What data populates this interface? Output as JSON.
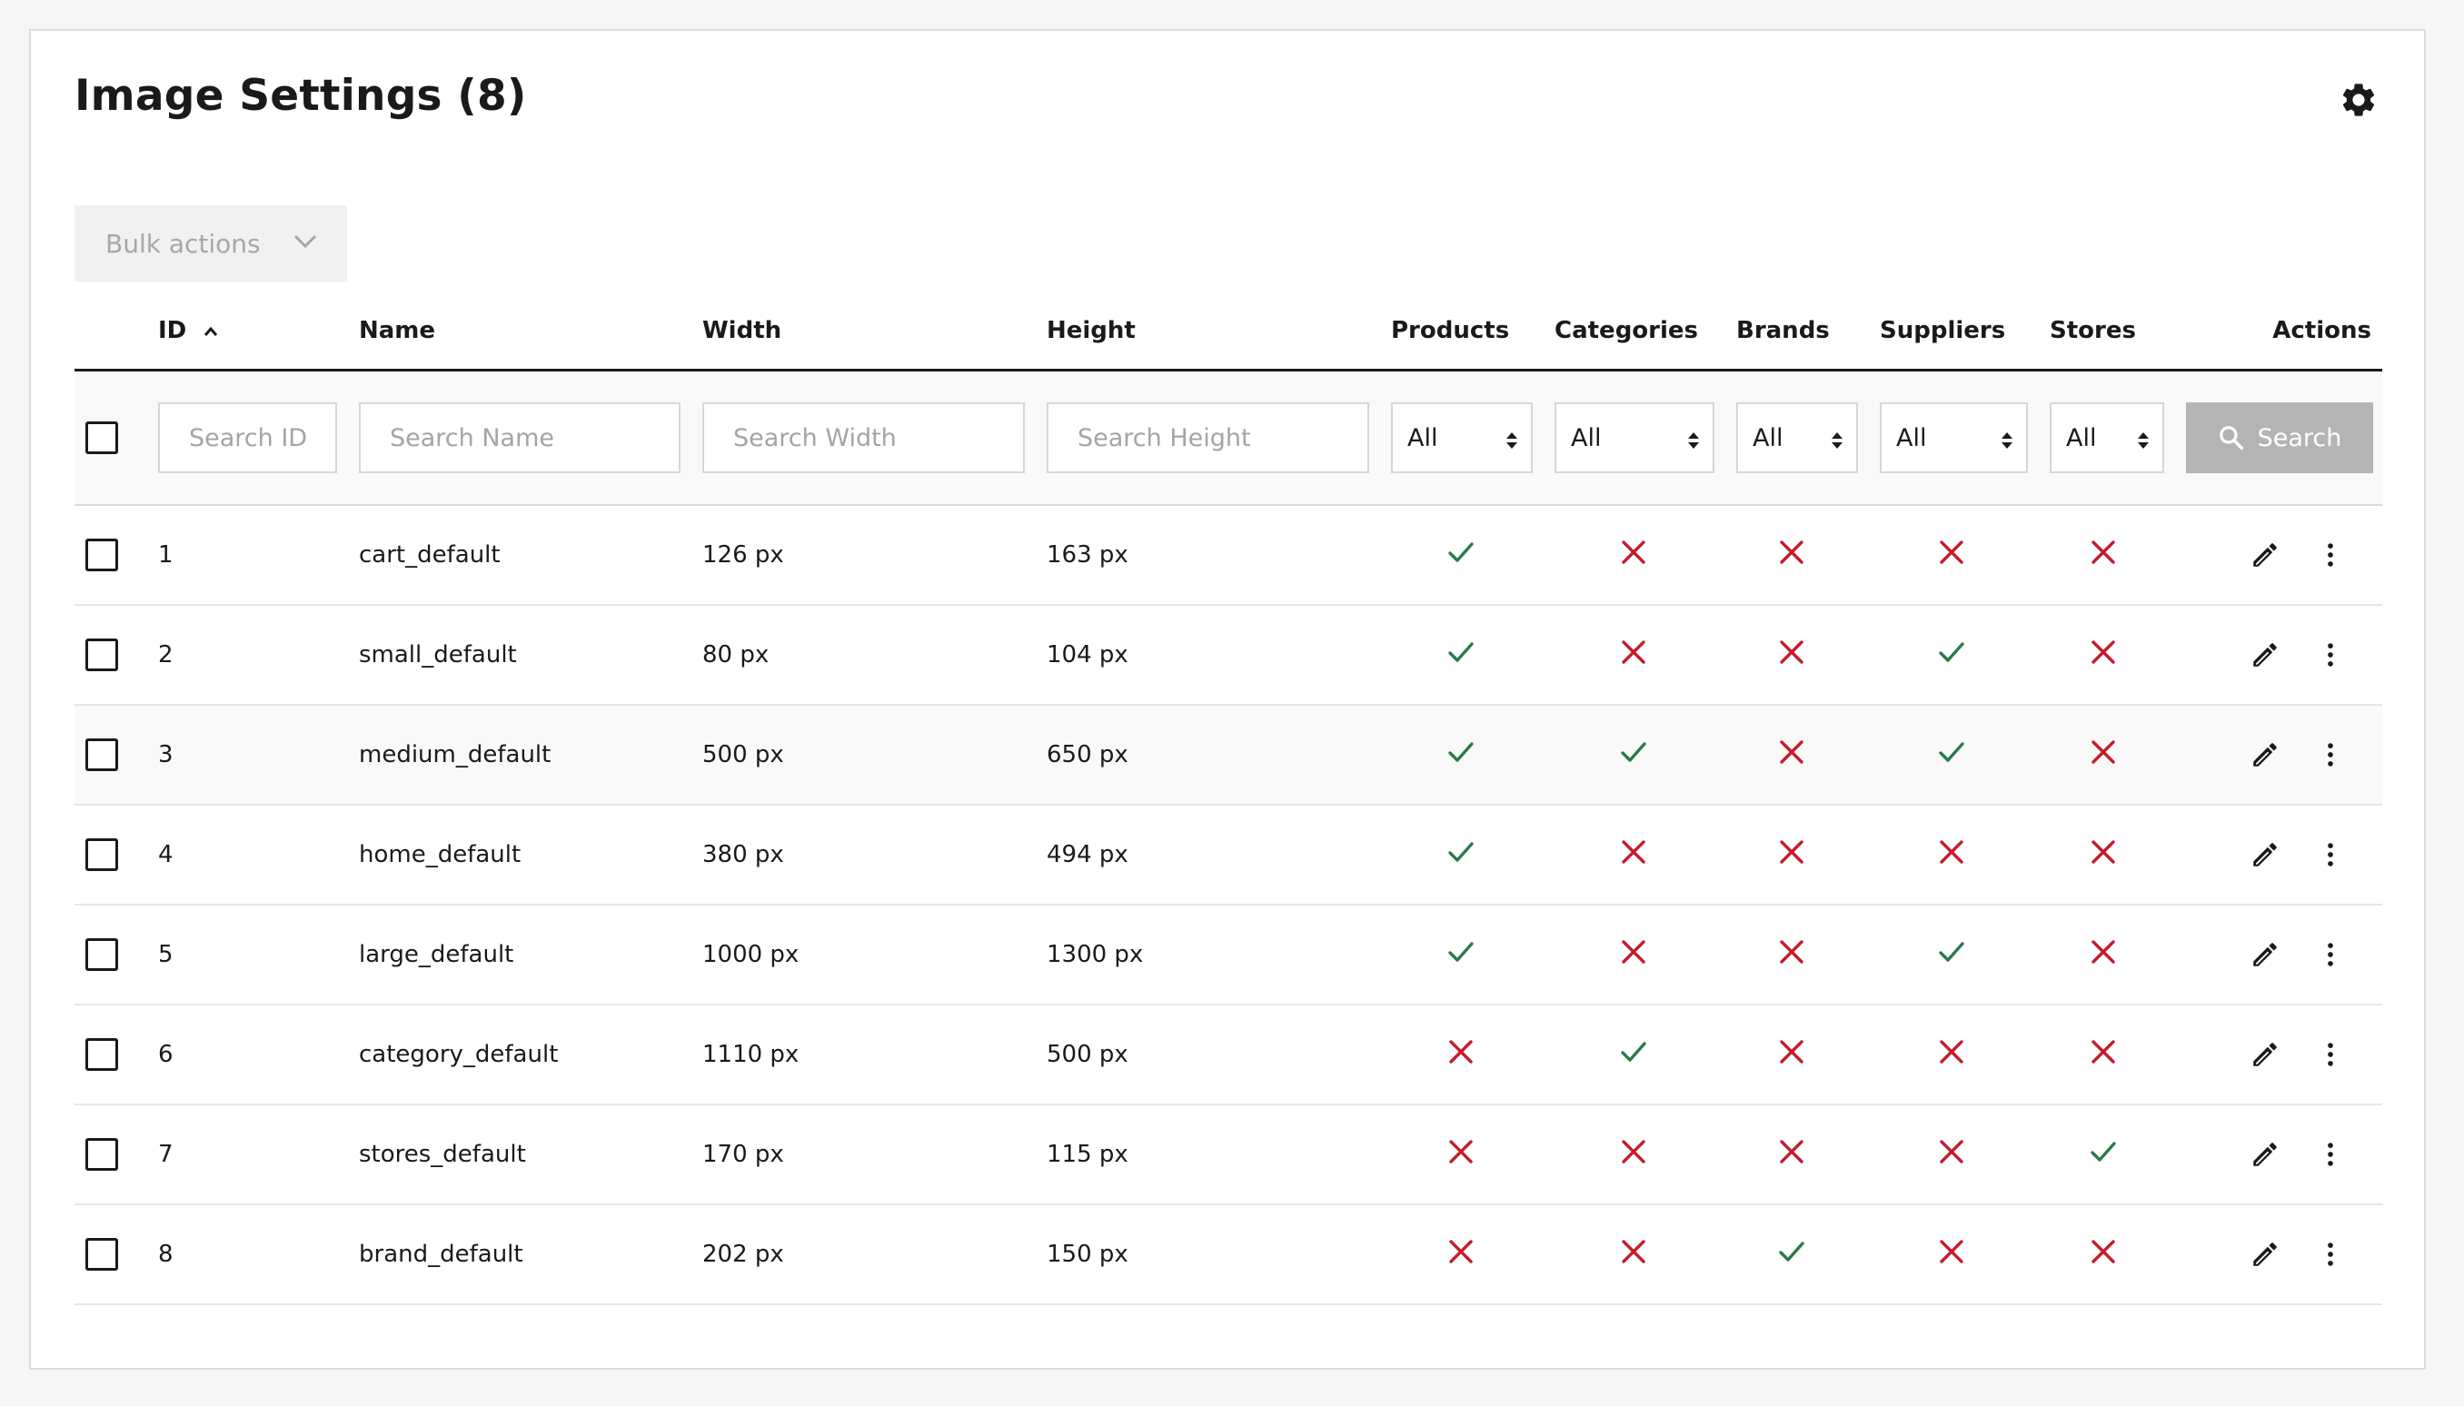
{
  "page": {
    "title": "Image Settings (8)",
    "settings_icon": "gear-icon"
  },
  "bulk_actions": {
    "label": "Bulk actions",
    "icon": "chevron-down-icon"
  },
  "columns": {
    "id": "ID",
    "name": "Name",
    "width": "Width",
    "height": "Height",
    "products": "Products",
    "categories": "Categories",
    "brands": "Brands",
    "suppliers": "Suppliers",
    "stores": "Stores",
    "actions": "Actions"
  },
  "filters": {
    "id_placeholder": "Search ID",
    "name_placeholder": "Search Name",
    "width_placeholder": "Search Width",
    "height_placeholder": "Search Height",
    "products": "All",
    "categories": "All",
    "brands": "All",
    "suppliers": "All",
    "stores": "All",
    "search_label": "Search"
  },
  "colors": {
    "check": "#2a7a4a",
    "cross": "#c41c2c",
    "button_disabled": "#b4b4b4"
  },
  "rows": [
    {
      "id": "1",
      "name": "cart_default",
      "width": "126 px",
      "height": "163 px",
      "products": true,
      "categories": false,
      "brands": false,
      "suppliers": false,
      "stores": false
    },
    {
      "id": "2",
      "name": "small_default",
      "width": "80 px",
      "height": "104 px",
      "products": true,
      "categories": false,
      "brands": false,
      "suppliers": true,
      "stores": false
    },
    {
      "id": "3",
      "name": "medium_default",
      "width": "500 px",
      "height": "650 px",
      "products": true,
      "categories": true,
      "brands": false,
      "suppliers": true,
      "stores": false
    },
    {
      "id": "4",
      "name": "home_default",
      "width": "380 px",
      "height": "494 px",
      "products": true,
      "categories": false,
      "brands": false,
      "suppliers": false,
      "stores": false
    },
    {
      "id": "5",
      "name": "large_default",
      "width": "1000 px",
      "height": "1300 px",
      "products": true,
      "categories": false,
      "brands": false,
      "suppliers": true,
      "stores": false
    },
    {
      "id": "6",
      "name": "category_default",
      "width": "1110 px",
      "height": "500 px",
      "products": false,
      "categories": true,
      "brands": false,
      "suppliers": false,
      "stores": false
    },
    {
      "id": "7",
      "name": "stores_default",
      "width": "170 px",
      "height": "115 px",
      "products": false,
      "categories": false,
      "brands": false,
      "suppliers": false,
      "stores": true
    },
    {
      "id": "8",
      "name": "brand_default",
      "width": "202 px",
      "height": "150 px",
      "products": false,
      "categories": false,
      "brands": true,
      "suppliers": false,
      "stores": false
    }
  ]
}
